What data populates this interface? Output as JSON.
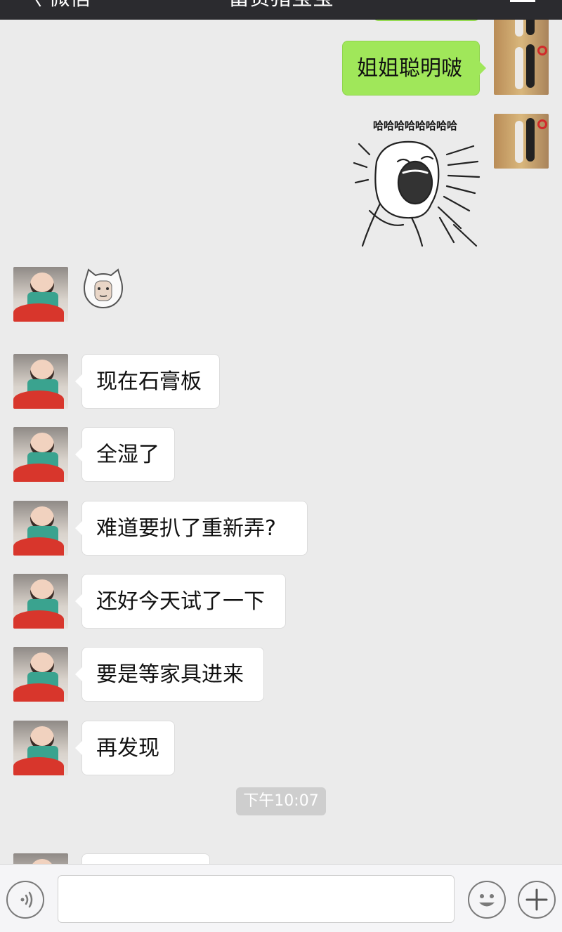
{
  "nav": {
    "back_label": "〈 微信",
    "title": "富贵猪宝宝"
  },
  "messages": {
    "self": [
      {
        "text": "姐姐聪明啵"
      }
    ],
    "sticker_caption": "哈哈哈哈哈哈哈哈",
    "other": [
      {
        "text": "现在石膏板"
      },
      {
        "text": "全湿了"
      },
      {
        "text": "难道要扒了重新弄?"
      },
      {
        "text": "还好今天试了一下"
      },
      {
        "text": "要是等家具进来"
      },
      {
        "text": "再发现"
      }
    ]
  },
  "timestamp": "下午10:07",
  "input": {
    "value": "",
    "placeholder": ""
  },
  "colors": {
    "self_bubble": "#a0e75a",
    "other_bubble": "#ffffff",
    "background": "#ebebeb",
    "navbar": "#2b2b2f"
  },
  "icons": [
    "voice-icon",
    "emoji-icon",
    "plus-icon",
    "back-chevron-icon",
    "menu-icon"
  ]
}
